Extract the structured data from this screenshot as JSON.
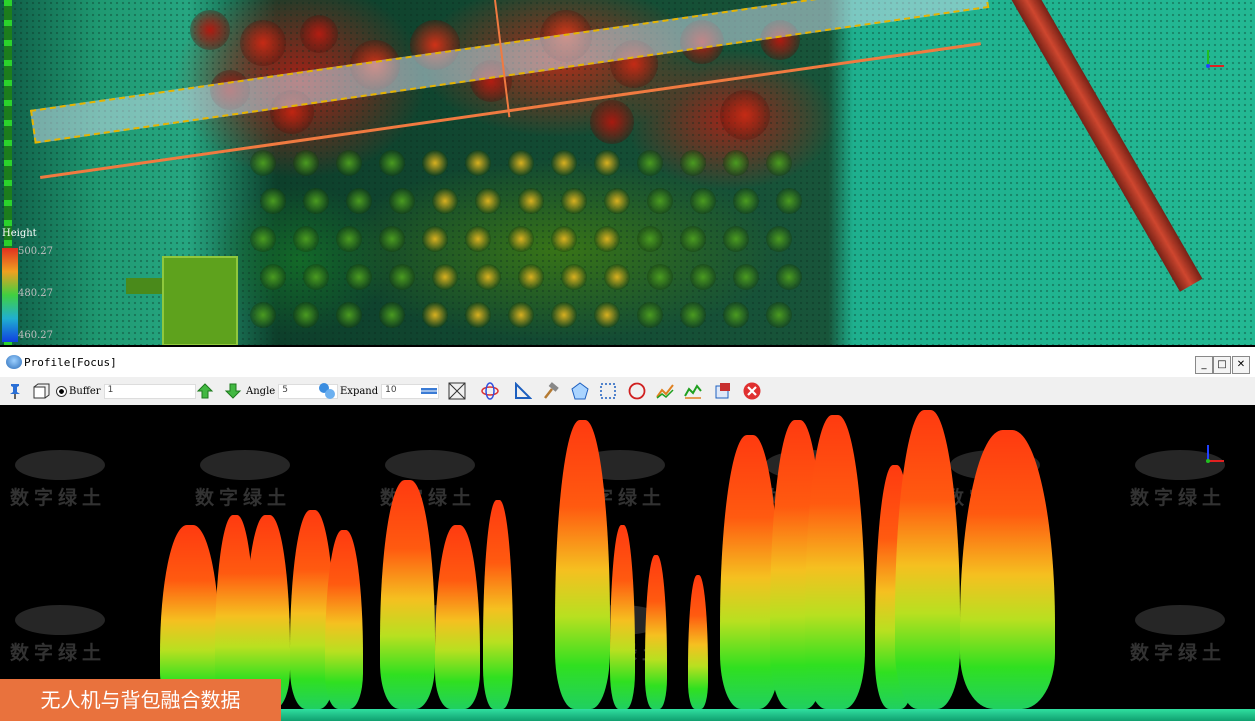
{
  "top_view": {
    "legend": {
      "title": "Height",
      "max": "500.27",
      "mid": "480.27",
      "min": "460.27"
    }
  },
  "profile_window": {
    "title": "Profile[Focus]",
    "window_buttons": {
      "minimize": "_",
      "maximize": "□",
      "close": "✕"
    },
    "toolbar": {
      "buffer_label": "Buffer",
      "buffer_value": "1",
      "angle_label": "Angle",
      "angle_value": "5",
      "expand_label": "Expand",
      "expand_value": "10"
    },
    "icons": [
      "pin-icon",
      "view-cube-icon",
      "arrow-up-icon",
      "arrow-down-icon",
      "expand-icon",
      "ruler-icon",
      "box-select-icon",
      "rotate-icon",
      "angle-measure-icon",
      "hammer-icon",
      "polygon-select-icon",
      "rect-select-icon",
      "circle-select-icon",
      "line-measure-icon",
      "profile-measure-icon",
      "export-icon",
      "close-red-icon"
    ]
  },
  "watermark": "数字绿土",
  "caption": "无人机与背包融合数据",
  "colors": {
    "caption_bg": "#e9723d",
    "high": "#ff3a10",
    "mid": "#f5c020",
    "low": "#30e020"
  }
}
